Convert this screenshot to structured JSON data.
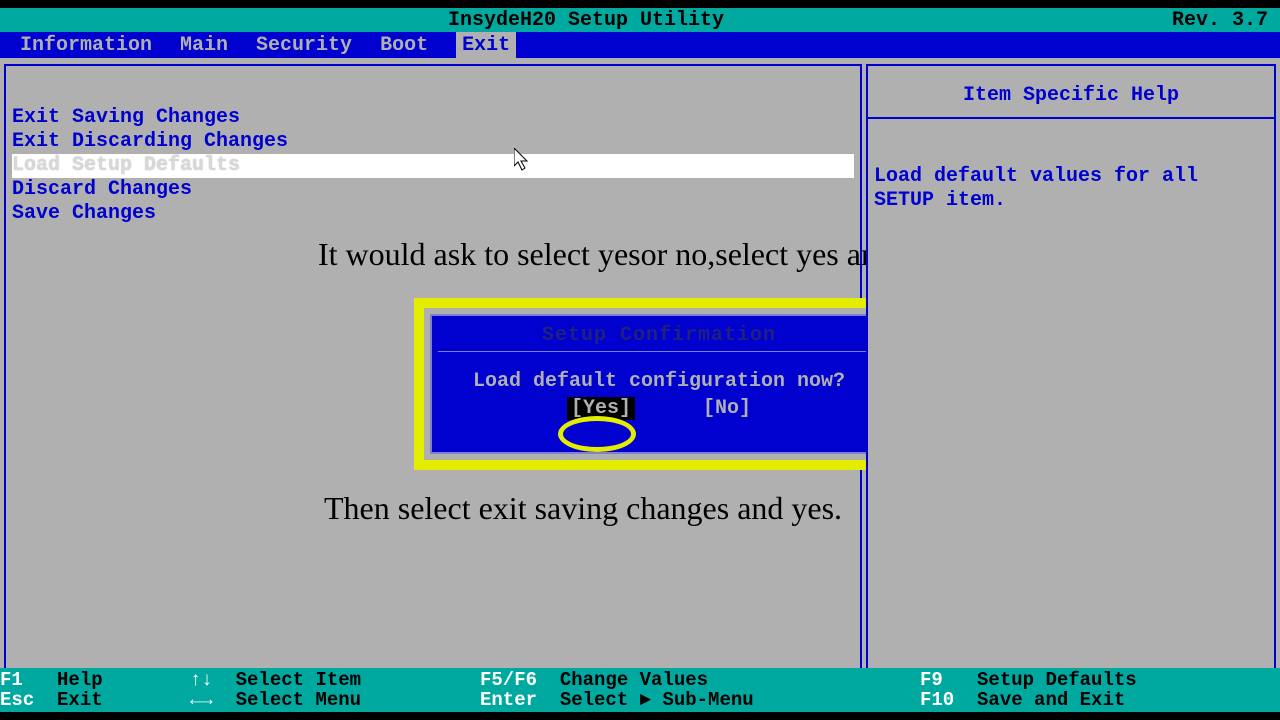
{
  "title": "InsydeH20 Setup Utility",
  "revision": "Rev. 3.7",
  "menubar": {
    "items": [
      "Information",
      "Main",
      "Security",
      "Boot",
      "Exit"
    ],
    "active_index": 4
  },
  "menu": {
    "items": [
      "Exit Saving Changes",
      "Exit Discarding Changes",
      "Load Setup Defaults",
      "Discard Changes",
      "Save Changes"
    ],
    "selected_index": 2
  },
  "help": {
    "title": "Item Specific Help",
    "body": "Load default values for all SETUP item."
  },
  "dialog": {
    "title": "Setup Confirmation",
    "question": "Load default configuration now?",
    "yes": "[Yes]",
    "no": "[No]",
    "selected": "yes"
  },
  "annotations": {
    "line1": "It would ask to select yesor no,select yes and hit enter",
    "line2": "Then select exit saving changes and yes."
  },
  "footer": {
    "f1": "F1",
    "f1_label": "Help",
    "esc": "Esc",
    "esc_label": "Exit",
    "updown": "↑↓",
    "updown_label": "Select Item",
    "leftright": "←→",
    "leftright_label": "Select Menu",
    "f5f6": "F5/F6",
    "f5f6_label": "Change Values",
    "enter": "Enter",
    "enter_label": "Select ► Sub-Menu",
    "f9": "F9",
    "f9_label": "Setup Defaults",
    "f10": "F10",
    "f10_label": "Save and Exit"
  }
}
